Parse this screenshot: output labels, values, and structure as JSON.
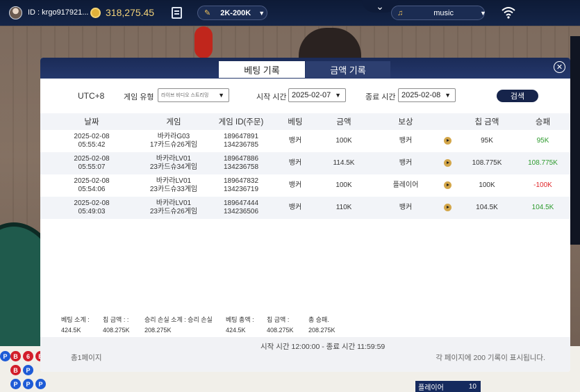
{
  "topbar": {
    "user_id": "ID : krgo917921...",
    "balance": "318,275.45",
    "limit": "2K-200K",
    "music": "music"
  },
  "modal": {
    "tabs": [
      "베팅 기록",
      "금액 기록"
    ],
    "filters": {
      "timezone": "UTC+8",
      "game_type_label": "게임 유형",
      "game_type_value": "라이브 비디오 스트리밍",
      "start_label": "시작 시간",
      "start_value": "2025-02-07",
      "end_label": "종료 시간",
      "end_value": "2025-02-08",
      "search": "검색"
    },
    "columns": [
      "날짜",
      "게임",
      "게임 ID(주문)",
      "베팅",
      "금액",
      "보상",
      "",
      "칩 금액",
      "승패"
    ],
    "rows": [
      {
        "date": "2025-02-08",
        "time": "05:55:42",
        "game1": "바카라G03",
        "game2": "17카드슈26게임",
        "id1": "189647891",
        "id2": "134236785",
        "bet": "뱅커",
        "amount": "100K",
        "result": "뱅커",
        "chip": "95K",
        "winloss": "95K",
        "wl": "win"
      },
      {
        "date": "2025-02-08",
        "time": "05:55:07",
        "game1": "바카라LV01",
        "game2": "23카드슈34게임",
        "id1": "189647886",
        "id2": "134236758",
        "bet": "뱅커",
        "amount": "114.5K",
        "result": "뱅커",
        "chip": "108.775K",
        "winloss": "108.775K",
        "wl": "win"
      },
      {
        "date": "2025-02-08",
        "time": "05:54:06",
        "game1": "바카라LV01",
        "game2": "23카드슈33게임",
        "id1": "189647832",
        "id2": "134236719",
        "bet": "뱅커",
        "amount": "100K",
        "result": "플레이어",
        "chip": "100K",
        "winloss": "-100K",
        "wl": "loss"
      },
      {
        "date": "2025-02-08",
        "time": "05:49:03",
        "game1": "바카라LV01",
        "game2": "23카드슈26게임",
        "id1": "189647444",
        "id2": "134236506",
        "bet": "뱅커",
        "amount": "110K",
        "result": "뱅커",
        "chip": "104.5K",
        "winloss": "104.5K",
        "wl": "win"
      }
    ],
    "summary": [
      {
        "label": "베팅 소계 :",
        "value": "424.5K"
      },
      {
        "label": "칩 금액 : :",
        "value": "408.275K"
      },
      {
        "label": "승리 손실 소계 : 승리 손실",
        "value": "208.275K"
      },
      {
        "label": "베팅 총액 :",
        "value": "424.5K"
      },
      {
        "label": "칩 금액 :",
        "value": "408.275K"
      },
      {
        "label": "총 승패.",
        "value": "208.275K"
      }
    ],
    "footer": {
      "range": "시작 시간 12:00:00 - 종료 시간 11:59:59",
      "page": "총1페이지",
      "per_page": "각 페이지에 200 기록이 표시됩니다."
    }
  },
  "side_chip": {
    "label": "플레이어",
    "value": "10"
  },
  "beads": [
    "P",
    "B",
    "6",
    "B",
    "B",
    "P",
    "P",
    "P",
    "P"
  ],
  "colors": {
    "navy": "#16244b",
    "win": "#2e9b2e",
    "loss": "#e0262a"
  }
}
